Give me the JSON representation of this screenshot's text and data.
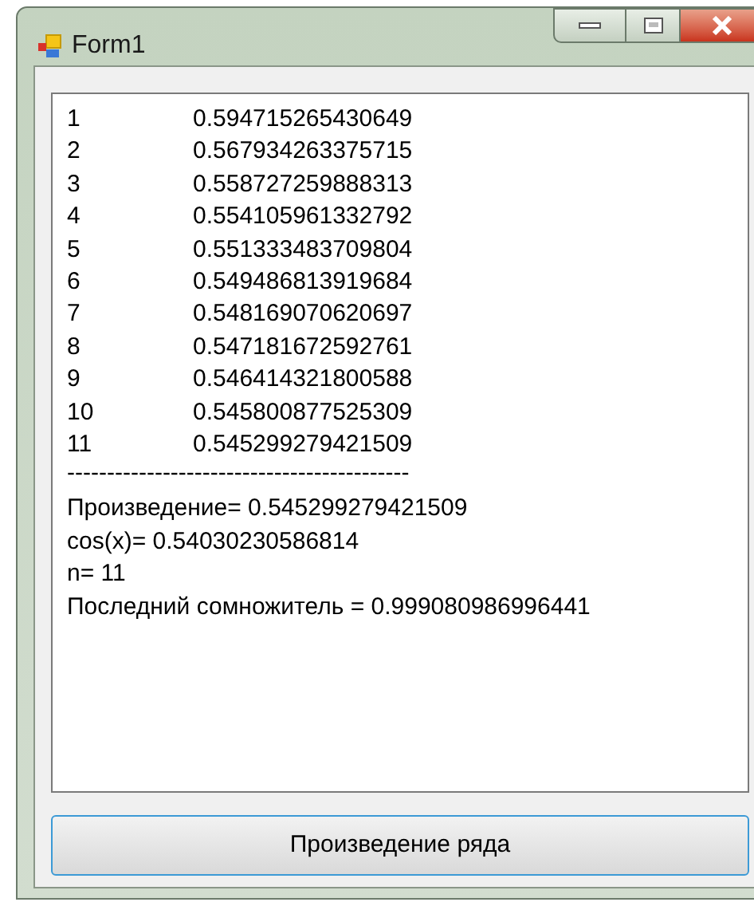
{
  "window": {
    "title": "Form1"
  },
  "output": {
    "rows": [
      {
        "n": "1",
        "value": "0.594715265430649"
      },
      {
        "n": "2",
        "value": "0.567934263375715"
      },
      {
        "n": "3",
        "value": "0.558727259888313"
      },
      {
        "n": "4",
        "value": "0.554105961332792"
      },
      {
        "n": "5",
        "value": "0.551333483709804"
      },
      {
        "n": "6",
        "value": "0.549486813919684"
      },
      {
        "n": "7",
        "value": "0.548169070620697"
      },
      {
        "n": "8",
        "value": "0.547181672592761"
      },
      {
        "n": "9",
        "value": "0.546414321800588"
      },
      {
        "n": "10",
        "value": "0.545800877525309"
      },
      {
        "n": "11",
        "value": "0.545299279421509"
      }
    ],
    "separator": "-------------------------------------------",
    "lines": [
      "Произведение= 0.545299279421509",
      "cos(x)= 0.54030230586814",
      "n= 11",
      "Последний сомножитель = 0.999080986996441"
    ]
  },
  "button": "Произведение ряда"
}
